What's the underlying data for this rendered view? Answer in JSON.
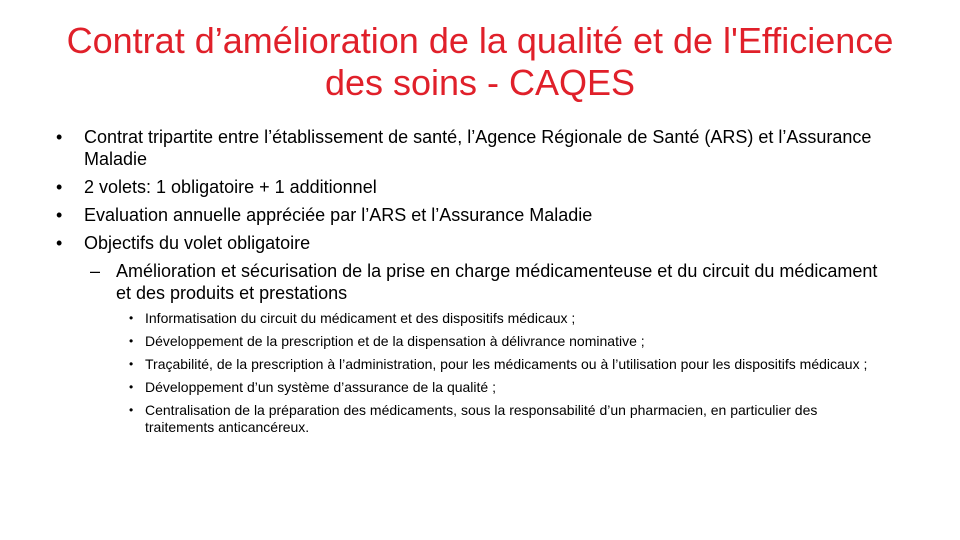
{
  "slide": {
    "title_line1": "Contrat d’amélioration de la qualité et de l'Efficience",
    "title_line2": "des soins - CAQES",
    "bullets": [
      "Contrat tripartite entre l’établissement  de santé, l’Agence  Régionale de Santé (ARS) et l’Assurance  Maladie",
      "2 volets: 1 obligatoire + 1 additionnel",
      "Evaluation  annuelle  appréciée par l’ARS et l’Assurance  Maladie",
      "Objectifs du volet obligatoire"
    ],
    "sub_bullet": "Amélioration  et sécurisation de la prise en charge médicamenteuse  et du circuit du médicament et des produits et prestations",
    "sub_sub_bullets": [
      "Informatisation  du circuit du médicament et des dispositifs médicaux ;",
      "Développement de la prescription et de la dispensation à délivrance nominative  ;",
      "Traçabilité, de la prescription à l’administration, pour les médicaments ou à l’utilisation pour les dispositifs médicaux ;",
      "Développement d’un système d’assurance de la qualité ;",
      "Centralisation de la préparation des médicaments, sous la responsabilité d’un pharmacien, en particulier des traitements anticancéreux."
    ],
    "bullet_glyphs": {
      "level1": "•",
      "level2": "–",
      "level3": "•"
    },
    "colors": {
      "title": "#e0202a",
      "text": "#000000",
      "background": "#ffffff"
    }
  }
}
